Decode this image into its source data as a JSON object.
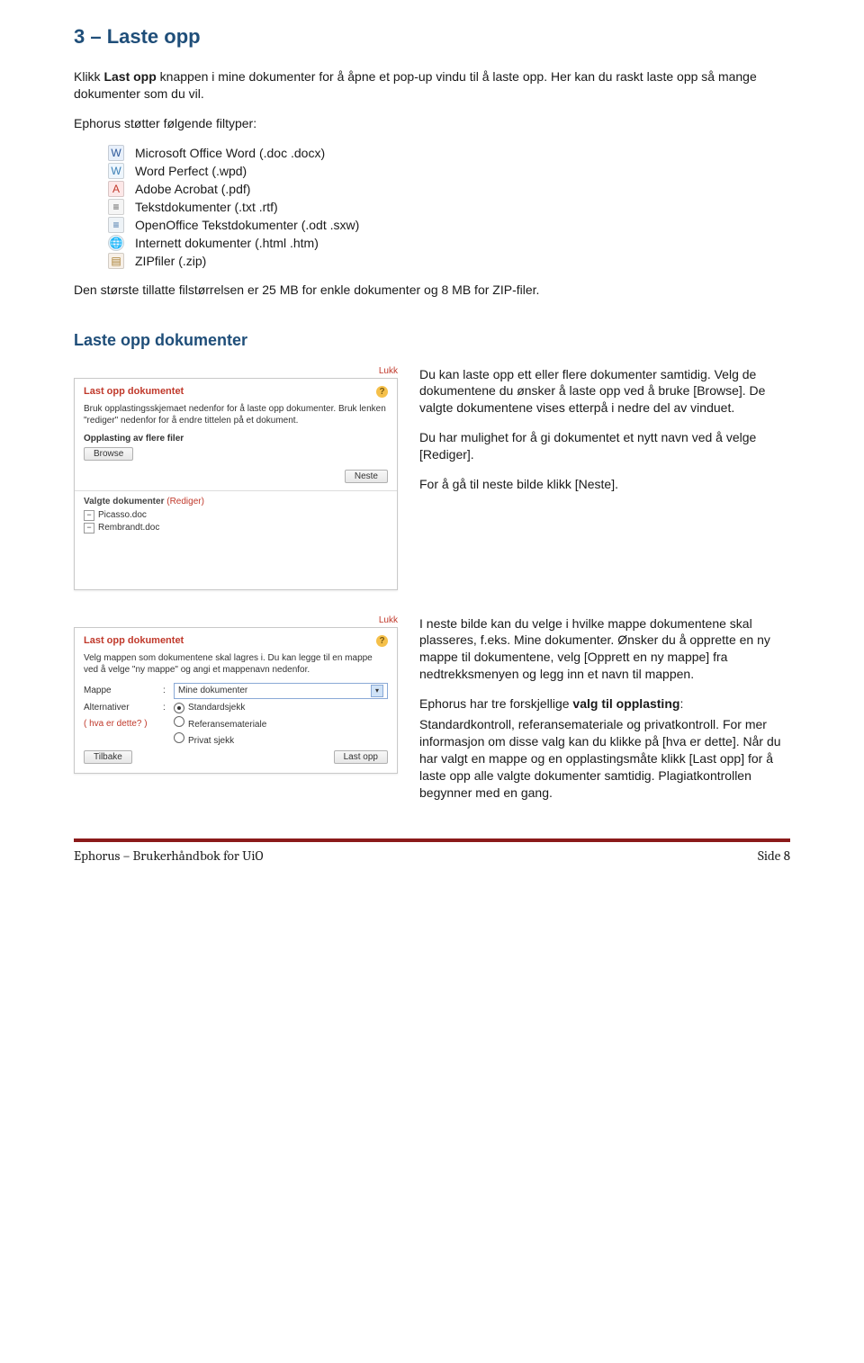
{
  "heading": "3 – Laste opp",
  "intro_parts": [
    "Klikk ",
    "Last opp",
    " knappen i mine dokumenter for å åpne et pop-up vindu til å laste opp. Her kan du raskt laste opp så mange dokumenter som du vil."
  ],
  "supports_line": "Ephorus støtter følgende filtyper:",
  "filetypes": [
    {
      "label": "Microsoft Office Word (.doc .docx)"
    },
    {
      "label": "Word Perfect (.wpd)"
    },
    {
      "label": "Adobe Acrobat (.pdf)"
    },
    {
      "label": "Tekstdokumenter (.txt .rtf)"
    },
    {
      "label": "OpenOffice Tekstdokumenter (.odt .sxw)"
    },
    {
      "label": "Internett dokumenter (.html .htm)"
    },
    {
      "label": "ZIPfiler (.zip)"
    }
  ],
  "max_size_line": "Den største tillatte filstørrelsen er 25 MB for enkle dokumenter og 8 MB for ZIP-filer.",
  "sub_heading": "Laste opp dokumenter",
  "side1": {
    "p1": "Du kan laste opp ett eller flere dokumenter samtidig. Velg de dokumentene du ønsker å laste opp ved å bruke [Browse]. De valgte dokumentene vises etterpå i nedre del av vinduet.",
    "p2": "Du har mulighet for å gi dokumentet et nytt navn ved å velge [Rediger].",
    "p3": "For å gå til neste bilde klikk [Neste]."
  },
  "side2": {
    "p1": "I neste bilde kan du velge i hvilke mappe dokumentene skal plasseres, f.eks. Mine dokumenter. Ønsker du å opprette en ny mappe til dokumentene, velg [Opprett en ny mappe] fra nedtrekksmenyen og legg inn et navn til mappen.",
    "p2_pre": "Ephorus har tre forskjellige ",
    "p2_bold": "valg til opplasting",
    "p2_post": ":",
    "p3": "Standardkontroll, referansemateriale og privatkontroll. For mer informasjon om disse valg kan du klikke på [hva er dette]. Når du har valgt en mappe og en opplastingsmåte klikk [Last opp] for å laste opp alle valgte dokumenter samtidig. Plagiatkontrollen begynner med en gang."
  },
  "shot1": {
    "close": "Lukk",
    "title": "Last opp dokumentet",
    "desc": "Bruk opplastingsskjemaet nedenfor for å laste opp dokumenter. Bruk lenken \"rediger\" nedenfor for å endre tittelen på et dokument.",
    "section": "Opplasting av flere filer",
    "browse": "Browse",
    "next": "Neste",
    "selected_label": "Valgte dokumenter",
    "edit": "(Rediger)",
    "docs": [
      "Picasso.doc",
      "Rembrandt.doc"
    ]
  },
  "shot2": {
    "close": "Lukk",
    "title": "Last opp dokumentet",
    "desc": "Velg mappen som dokumentene skal lagres i. Du kan legge til en mappe ved å velge \"ny mappe\" og angi et mappenavn nedenfor.",
    "folder_label": "Mappe",
    "folder_value": "Mine dokumenter",
    "alt_label": "Alternativer",
    "hva": "( hva er dette? )",
    "opts": [
      "Standardsjekk",
      "Referansemateriale",
      "Privat sjekk"
    ],
    "back": "Tilbake",
    "upload": "Last opp"
  },
  "footer": {
    "left": "Ephorus – Brukerhåndbok for UiO",
    "right": "Side 8"
  }
}
